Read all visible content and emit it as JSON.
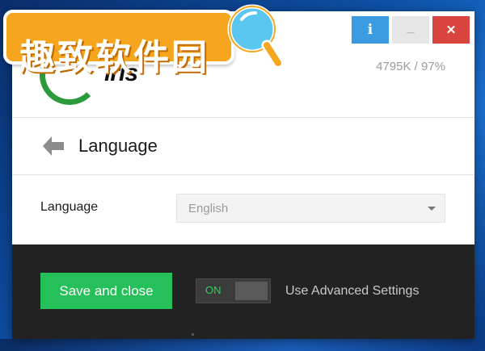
{
  "window": {
    "info_label": "i",
    "minimize_label": "_",
    "close_label": "✕",
    "stats": "4795K / 97%"
  },
  "logo": {
    "text": "iris",
    "brand_color": "#2a9a3a"
  },
  "header": {
    "title": "Language"
  },
  "settings": {
    "language_label": "Language",
    "language_value": "English"
  },
  "footer": {
    "save_label": "Save and close",
    "toggle_state": "ON",
    "advanced_label": "Use Advanced Settings"
  },
  "watermark": {
    "text": "趣致软件园"
  },
  "colors": {
    "accent_green": "#26c05a",
    "info_blue": "#3a9be0",
    "close_red": "#d9453e",
    "footer_bg": "#222222",
    "watermark_orange": "#f6a51f"
  },
  "icons": {
    "back": "back-arrow-icon",
    "caret": "chevron-down-icon",
    "magnifier": "magnifier-icon"
  }
}
